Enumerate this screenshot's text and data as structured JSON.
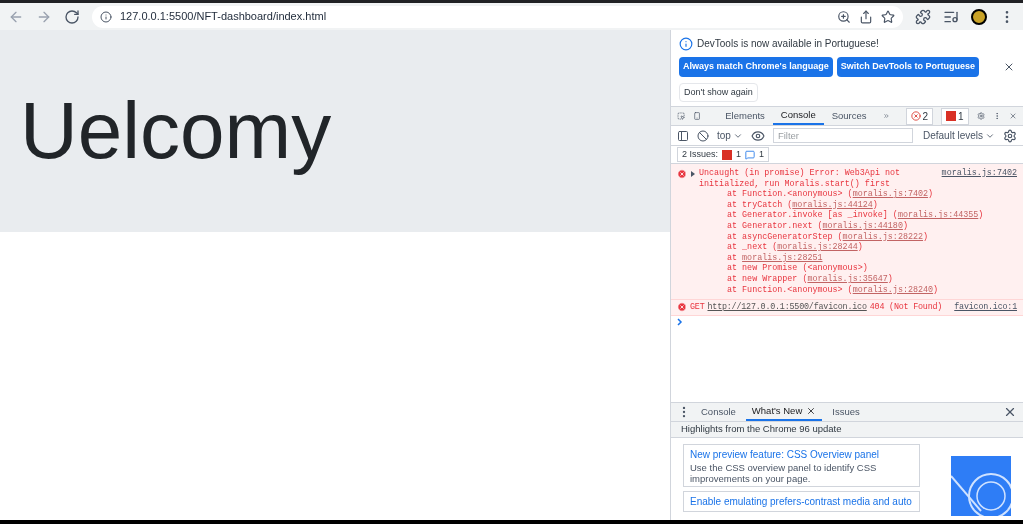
{
  "browser": {
    "url": "127.0.0.1:5500/NFT-dashboard/index.html"
  },
  "page": {
    "heading": "Uelcomy"
  },
  "devtools": {
    "infobar": {
      "message": "DevTools is now available in Portuguese!",
      "buttons": [
        "Always match Chrome's language",
        "Switch DevTools to Portuguese"
      ],
      "dismiss": "Don't show again"
    },
    "tabs": [
      {
        "label": "Elements",
        "selected": false
      },
      {
        "label": "Console",
        "selected": true
      },
      {
        "label": "Sources",
        "selected": false
      }
    ],
    "error_count": "2",
    "issue_count": "1",
    "toolbar": {
      "context": "top",
      "filter_placeholder": "Filter",
      "levels": "Default levels"
    },
    "issues": {
      "label": "2 Issues:",
      "errors": "1",
      "info": "1"
    },
    "messages": [
      {
        "kind": "exception",
        "text": "Uncaught (in promise) Error: Web3Api not initialized, run Moralis.start() first",
        "source": "moralis.js:7402",
        "expanded": false,
        "trace": [
          {
            "before": "at Function.<anonymous> (",
            "link": "moralis.js:7402",
            "after": ")"
          },
          {
            "before": "at tryCatch (",
            "link": "moralis.js:44124",
            "after": ")"
          },
          {
            "before": "at Generator.invoke [as _invoke] (",
            "link": "moralis.js:44355",
            "after": ")"
          },
          {
            "before": "at Generator.next (",
            "link": "moralis.js:44180",
            "after": ")"
          },
          {
            "before": "at asyncGeneratorStep (",
            "link": "moralis.js:28222",
            "after": ")"
          },
          {
            "before": "at _next (",
            "link": "moralis.js:28244",
            "after": ")"
          },
          {
            "before": "at ",
            "link": "moralis.js:28251"
          },
          {
            "before": "at new Promise (<anonymous>)"
          },
          {
            "before": "at new Wrapper (",
            "link": "moralis.js:35647",
            "after": ")"
          },
          {
            "before": "at Function.<anonymous> (",
            "link": "moralis.js:28240",
            "after": ")"
          }
        ]
      },
      {
        "kind": "network",
        "method": "GET",
        "url": "http://127.0.0.1:5500/favicon.ico",
        "status": "404 (Not Found)",
        "source": "favicon.ico:1"
      }
    ],
    "drawer": {
      "tabs": [
        {
          "label": "Console",
          "selected": false,
          "closable": false
        },
        {
          "label": "What's New",
          "selected": true,
          "closable": true
        },
        {
          "label": "Issues",
          "selected": false,
          "closable": false
        }
      ],
      "header": "Highlights from the Chrome 96 update",
      "cards": [
        {
          "title": "New preview feature: CSS Overview panel",
          "body": "Use the CSS overview panel to identify CSS improvements on your page."
        },
        {
          "title": "Enable emulating prefers-contrast media and auto"
        }
      ]
    }
  }
}
